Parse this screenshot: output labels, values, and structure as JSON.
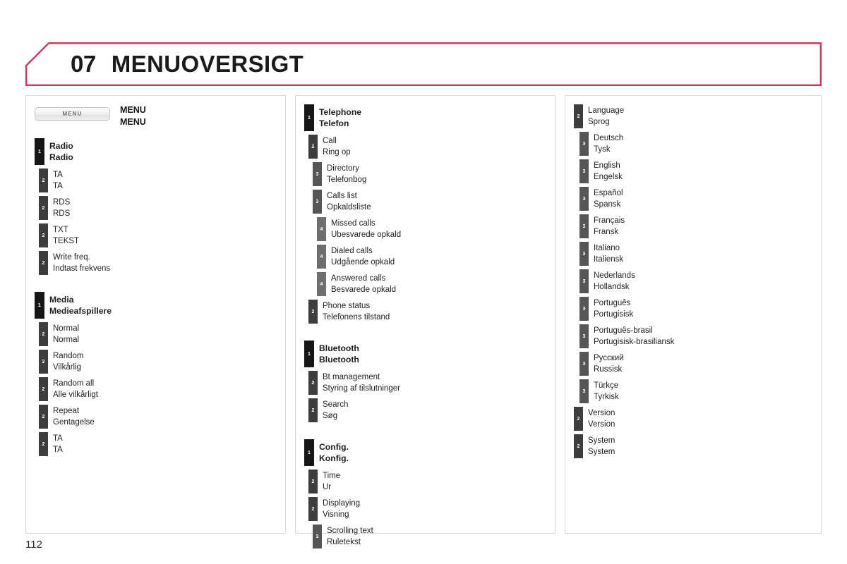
{
  "header": {
    "chapter_number": "07",
    "chapter_title": "MENUOVERSIGT",
    "accent_color": "#d1365a"
  },
  "page_number": "112",
  "columns": [
    {
      "name": "column-left",
      "menu_key": {
        "key_label": "MENU",
        "en": "MENU",
        "da": "MENU"
      },
      "entries": [
        {
          "level": 1,
          "en": "Radio",
          "da": "Radio",
          "gap_before": false
        },
        {
          "level": 2,
          "en": "TA",
          "da": "TA",
          "gap_before": false
        },
        {
          "level": 2,
          "en": "RDS",
          "da": "RDS",
          "gap_before": false
        },
        {
          "level": 2,
          "en": "TXT",
          "da": "TEKST",
          "gap_before": false
        },
        {
          "level": 2,
          "en": "Write freq.",
          "da": "Indtast frekvens",
          "gap_before": false
        },
        {
          "level": 1,
          "en": "Media",
          "da": "Medieafspillere",
          "gap_before": true
        },
        {
          "level": 2,
          "en": "Normal",
          "da": "Normal",
          "gap_before": false
        },
        {
          "level": 2,
          "en": "Random",
          "da": "Vilkårlig",
          "gap_before": false
        },
        {
          "level": 2,
          "en": "Random all",
          "da": "Alle vilkårligt",
          "gap_before": false
        },
        {
          "level": 2,
          "en": "Repeat",
          "da": "Gentagelse",
          "gap_before": false
        },
        {
          "level": 2,
          "en": "TA",
          "da": "TA",
          "gap_before": false
        }
      ]
    },
    {
      "name": "column-middle",
      "entries": [
        {
          "level": 1,
          "en": "Telephone",
          "da": "Telefon",
          "gap_before": false
        },
        {
          "level": 2,
          "en": "Call",
          "da": "Ring op",
          "gap_before": false
        },
        {
          "level": 3,
          "en": "Directory",
          "da": "Telefonbog",
          "gap_before": false
        },
        {
          "level": 3,
          "en": "Calls list",
          "da": "Opkaldsliste",
          "gap_before": false
        },
        {
          "level": 4,
          "en": "Missed calls",
          "da": "Ubesvarede opkald",
          "gap_before": false
        },
        {
          "level": 4,
          "en": "Dialed calls",
          "da": "Udgående opkald",
          "gap_before": false
        },
        {
          "level": 4,
          "en": "Answered calls",
          "da": "Besvarede opkald",
          "gap_before": false
        },
        {
          "level": 2,
          "en": "Phone status",
          "da": "Telefonens tilstand",
          "gap_before": false
        },
        {
          "level": 1,
          "en": "Bluetooth",
          "da": "Bluetooth",
          "gap_before": true
        },
        {
          "level": 2,
          "en": "Bt management",
          "da": "Styring af tilslutninger",
          "gap_before": false
        },
        {
          "level": 2,
          "en": "Search",
          "da": "Søg",
          "gap_before": false
        },
        {
          "level": 1,
          "en": "Config.",
          "da": "Konfig.",
          "gap_before": true
        },
        {
          "level": 2,
          "en": "Time",
          "da": "Ur",
          "gap_before": false
        },
        {
          "level": 2,
          "en": "Displaying",
          "da": "Visning",
          "gap_before": false
        },
        {
          "level": 3,
          "en": "Scrolling text",
          "da": "Ruletekst",
          "gap_before": false
        }
      ]
    },
    {
      "name": "column-right",
      "entries": [
        {
          "level": 2,
          "en": "Language",
          "da": "Sprog",
          "gap_before": false
        },
        {
          "level": 3,
          "en": "Deutsch",
          "da": "Tysk",
          "gap_before": false
        },
        {
          "level": 3,
          "en": "English",
          "da": "Engelsk",
          "gap_before": false
        },
        {
          "level": 3,
          "en": "Español",
          "da": "Spansk",
          "gap_before": false
        },
        {
          "level": 3,
          "en": "Français",
          "da": "Fransk",
          "gap_before": false
        },
        {
          "level": 3,
          "en": "Italiano",
          "da": "Italiensk",
          "gap_before": false
        },
        {
          "level": 3,
          "en": "Nederlands",
          "da": "Hollandsk",
          "gap_before": false
        },
        {
          "level": 3,
          "en": "Português",
          "da": "Portugisisk",
          "gap_before": false
        },
        {
          "level": 3,
          "en": "Português-brasil",
          "da": "Portugisisk-brasiliansk",
          "gap_before": false
        },
        {
          "level": 3,
          "en": "Русский",
          "da": "Russisk",
          "gap_before": false
        },
        {
          "level": 3,
          "en": "Türkçe",
          "da": "Tyrkisk",
          "gap_before": false
        },
        {
          "level": 2,
          "en": "Version",
          "da": "Version",
          "gap_before": false
        },
        {
          "level": 2,
          "en": "System",
          "da": "System",
          "gap_before": false
        }
      ]
    }
  ]
}
